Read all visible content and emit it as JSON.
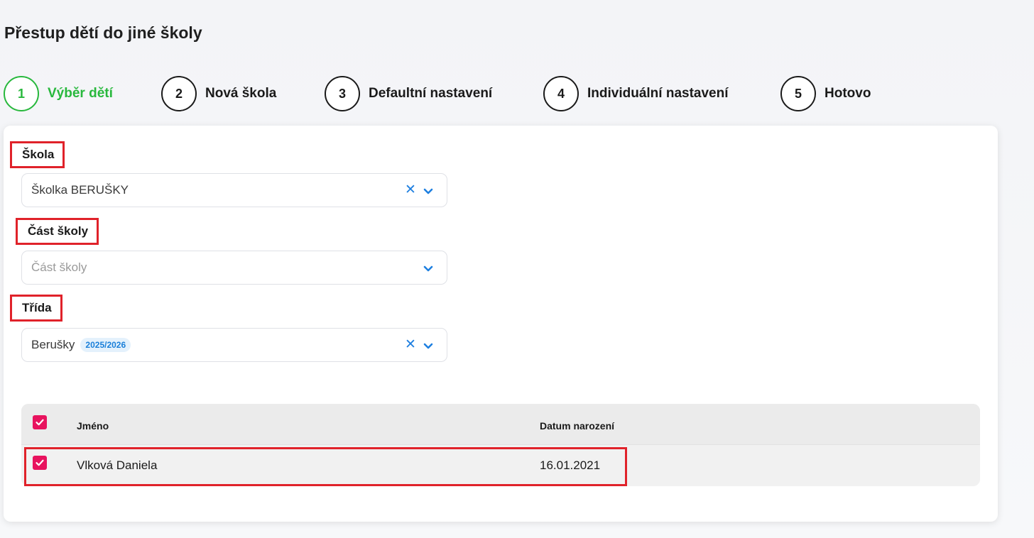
{
  "page": {
    "title": "Přestup dětí do jiné školy"
  },
  "stepper": {
    "steps": [
      {
        "number": "1",
        "label": "Výběr dětí",
        "active": true
      },
      {
        "number": "2",
        "label": "Nová škola",
        "active": false
      },
      {
        "number": "3",
        "label": "Defaultní nastavení",
        "active": false
      },
      {
        "number": "4",
        "label": "Individuální nastavení",
        "active": false
      },
      {
        "number": "5",
        "label": "Hotovo",
        "active": false
      }
    ]
  },
  "form": {
    "school": {
      "label": "Škola",
      "value": "Školka BERUŠKY"
    },
    "school_part": {
      "label": "Část školy",
      "placeholder": "Část školy"
    },
    "class": {
      "label": "Třída",
      "value": "Berušky",
      "badge": "2025/2026"
    }
  },
  "table": {
    "headers": {
      "name": "Jméno",
      "birth_date": "Datum narození"
    },
    "rows": [
      {
        "name": "Vlková Daniela",
        "birth_date": "16.01.2021",
        "checked": true
      }
    ],
    "select_all_checked": true
  },
  "colors": {
    "active_step": "#28b83d",
    "checkbox": "#e8135e",
    "highlight": "#e0222a",
    "accent_icon": "#1e7fe0"
  }
}
